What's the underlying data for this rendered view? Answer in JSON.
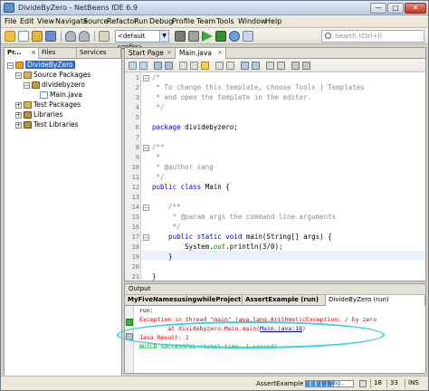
{
  "window": {
    "title": "DivideByZero - NetBeans IDE 6.9",
    "min_glyph": "—",
    "max_glyph": "□",
    "close_glyph": "✕"
  },
  "menu": [
    "File",
    "Edit",
    "View",
    "Navigate",
    "Source",
    "Refactor",
    "Run",
    "Debug",
    "Profile",
    "Team",
    "Tools",
    "Window",
    "Help"
  ],
  "toolbar": {
    "config": "<default config>",
    "config_arrow": "▼",
    "search_placeholder": "Search (Ctrl+I)",
    "icons": [
      "new-project-icon",
      "new-file-icon",
      "open-project-icon",
      "save-all-icon",
      "undo-icon",
      "redo-icon",
      "build-icon",
      "clean-build-icon",
      "run-icon",
      "debug-icon",
      "profile-icon",
      "profile-start-icon"
    ]
  },
  "left_panel": {
    "tabs": [
      "Pr...",
      "Files",
      "Services"
    ],
    "close_glyph": "×",
    "tree": {
      "project": "DivideByZero",
      "source_packages": "Source Packages",
      "package": "dividebyzero",
      "file": "Main.java",
      "test_packages": "Test Packages",
      "libraries": "Libraries",
      "test_libraries": "Test Libraries"
    },
    "toggle_expanded": "−",
    "toggle_collapsed": "+"
  },
  "editor": {
    "tabs": [
      "Start Page",
      "Main.java"
    ],
    "close_glyph": "×",
    "line_numbers": [
      "1",
      "2",
      "3",
      "4",
      "5",
      "6",
      "7",
      "8",
      "9",
      "10",
      "11",
      "12",
      "13",
      "14",
      "15",
      "16",
      "17",
      "18",
      "19",
      "20",
      "21"
    ],
    "code": {
      "l1": "/*",
      "l2": " * To change this template, choose Tools | Templates",
      "l3": " * and open the template in the editor.",
      "l4": " */",
      "l6_kw": "package",
      "l6_rest": " dividebyzero;",
      "l8": "/**",
      "l9": " *",
      "l10": " * @author sang",
      "l11": " */",
      "l12_kw": "public class",
      "l12_rest": " Main {",
      "l14": "    /**",
      "l15": "     * @param args the command line arguments",
      "l16": "     */",
      "l17_kw": "    public static void",
      "l17_rest": " main(String[] args) {",
      "l18_a": "        System.",
      "l18_field": "out",
      "l18_b": ".println(3/0);",
      "l19": "    }",
      "l21": "}"
    },
    "fold_open": "−"
  },
  "output": {
    "header": "Output",
    "tabs": [
      "MyFiveNamesusingwhileProject (run)",
      "AssertExample (run)",
      "DivideByZero (run)"
    ],
    "lines": {
      "l1": "run:",
      "l2": "Exception in thread \"main\" java.lang.ArithmeticException: / by zero",
      "l3_a": "        at dividebyzero.Main.main(",
      "l3_link": "Main.java:18",
      "l3_b": ")",
      "l4": "Java Result: 1",
      "l5": "BUILD SUCCESSFUL (total time: 1 second)"
    }
  },
  "statusbar": {
    "task": "AssertExample (run)",
    "progress_fraction": 0.6,
    "running": "running...",
    "line": "18",
    "col": "33",
    "mode": "INS"
  }
}
